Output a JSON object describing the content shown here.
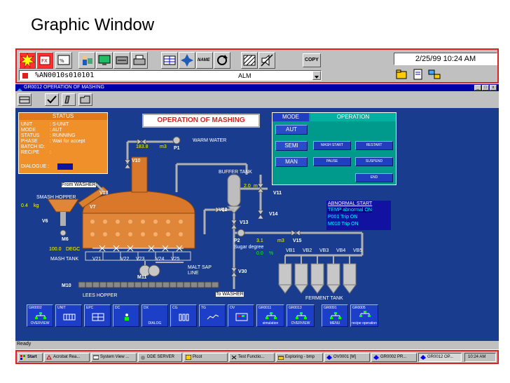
{
  "slide_title": "Graphic Window",
  "top_toolbar": {
    "datetime": "2/25/99 10:24 AM",
    "copy_label": "COPY",
    "name_label": "NAME"
  },
  "alarm_bar": {
    "tag": "%AN0010s010101",
    "type": "ALM"
  },
  "window": {
    "title": "GR0012 OPERATION OF MASHING",
    "controls": [
      "_",
      "□",
      "x"
    ]
  },
  "status_panel": {
    "header": "STATUS",
    "rows": [
      {
        "key": "UNIT",
        "value": ": S-UNIT"
      },
      {
        "key": "MODE",
        "value": ": AUT"
      },
      {
        "key": "STATUS",
        "value": ": RUNNING"
      },
      {
        "key": "PHASE",
        "value": ": Wait for accept"
      },
      {
        "key": "BATCH ID:",
        "value": ""
      },
      {
        "key": "RECIPE",
        "value": ":"
      }
    ],
    "dialogue": "DIALOGUE :"
  },
  "process_title": "OPERATION OF MASHING",
  "mode_panel": {
    "mode_header": "MODE",
    "operation_header": "OPERATION",
    "modes": [
      "AUT",
      "SEMI",
      "MAN"
    ],
    "operations": [
      "MASH START",
      "RESTART",
      "PAUSE",
      "SUSPEND",
      "END"
    ]
  },
  "alarm_list": {
    "header": "ABNORMAL START",
    "items": [
      "TEMP abnormal ON",
      "P001 Trip ON",
      "M010 Trip ON"
    ]
  },
  "labels": {
    "warm_water": "WARM WATER",
    "flow_value": "183.8",
    "flow_unit": "m3",
    "p1": "P1",
    "v10": "V10",
    "v18": "V18",
    "v7": "V7",
    "v6": "V6",
    "m6": "M6",
    "from_washer": "From WASHER",
    "smash_hopper": "SMASH HOPPER",
    "hopper_value": "0.4",
    "hopper_unit": "kg",
    "temp_value": "100.0",
    "temp_unit": "DEGC",
    "mash_tank": "MASH TANK",
    "buffer_tank": "BUFFER TANK",
    "level_value": "2.0",
    "level_unit": "m",
    "v11": "V11",
    "v12": "V12",
    "v14": "V14",
    "v13": "V13",
    "p2": "P2",
    "p2_value": "3.1",
    "p2_unit": "m3",
    "v15": "V15",
    "sugar_degree": "Sugar degree",
    "sugar_value": "0.0",
    "sugar_unit": "%",
    "v21": "V21",
    "v22": "V22",
    "v23": "V23",
    "v24": "V24",
    "v25": "V25",
    "m11": "M11",
    "malt_sap_line": "MALT SAP LINE",
    "v30": "V30",
    "to_washer": "To WASHER",
    "m10": "M10",
    "lees_hopper": "LEES HOPPER",
    "ferment_tank": "FERMENT TANK",
    "vb": [
      "VB1",
      "VB2",
      "VB3",
      "VB4",
      "VB5"
    ]
  },
  "nav_buttons": [
    {
      "top": "GR0002",
      "bottom": "OVERVIEW"
    },
    {
      "top": "UNIT",
      "bottom": ""
    },
    {
      "top": "EPC",
      "bottom": ""
    },
    {
      "top": "DC",
      "bottom": ""
    },
    {
      "top": "DX",
      "bottom": "DIALOG"
    },
    {
      "top": "CG",
      "bottom": ""
    },
    {
      "top": "TG",
      "bottom": ""
    },
    {
      "top": "OV",
      "bottom": ""
    },
    {
      "top": "GR0011",
      "bottom": "simulation"
    },
    {
      "top": "GR0013",
      "bottom": "OVERVIEW"
    },
    {
      "top": "GR0091",
      "bottom": "MENU"
    },
    {
      "top": "GR0005",
      "bottom": "recipe operation"
    }
  ],
  "status_bar": "Ready",
  "taskbar": {
    "start": "Start",
    "items": [
      "Acrobat Rea...",
      "System View ...",
      "DDE SERVER",
      "Picot",
      "Test Functio...",
      "Exploring - bmp",
      "OV0001 [M]",
      "GR0002 PR...",
      "GR0012 OP..."
    ],
    "clock": "10:24 AM"
  },
  "colors": {
    "panel_bg": "#1a3c8e",
    "status_bg": "#f0902a",
    "mode_bg": "#009a8c",
    "tank_copper": "#d9782a",
    "pipe": "#b0b0b0",
    "alarm_bg": "#1212a0",
    "alarm_text": "#00ffff",
    "frame_red": "#e02020"
  }
}
